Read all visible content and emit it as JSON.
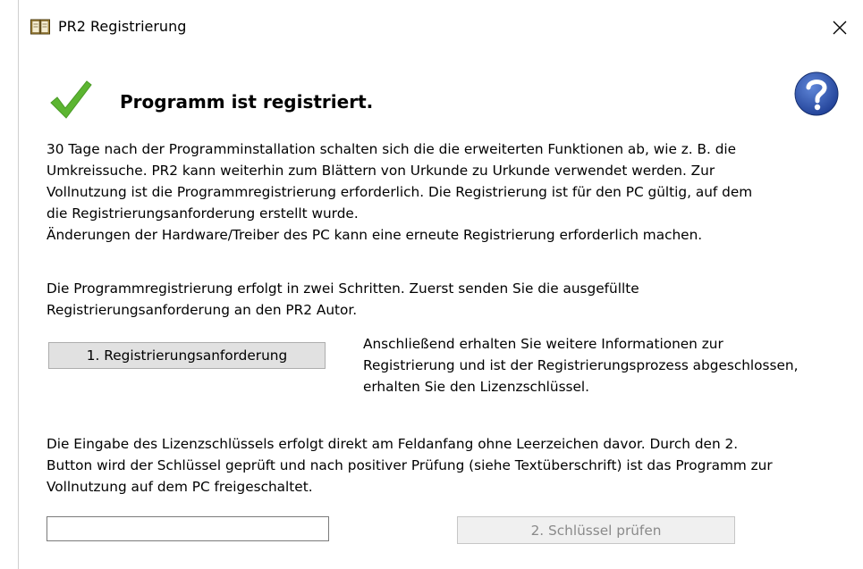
{
  "window": {
    "title": "PR2 Registrierung",
    "close_label": "✕"
  },
  "status": {
    "heading": "Programm ist registriert.",
    "icon": "checkmark-icon",
    "color": "#5cb531"
  },
  "help": {
    "icon": "help-icon",
    "label": "?",
    "color": "#2a4fa8"
  },
  "paragraphs": {
    "p1": "30 Tage nach der Programminstallation schalten sich die die erweiterten Funktionen ab, wie z. B. die\nUmkreissuche. PR2 kann weiterhin zum Blättern von Urkunde zu Urkunde verwendet werden. Zur\nVollnutzung ist die Programmregistrierung erforderlich. Die Registrierung ist für den PC gültig, auf dem\ndie Registrierungsanforderung erstellt wurde.\nÄnderungen der Hardware/Treiber des PC kann eine erneute Registrierung erforderlich machen.",
    "p2": "Die Programmregistrierung erfolgt in zwei Schritten. Zuerst senden Sie die ausgefüllte\nRegistrierungsanforderung an den PR2 Autor.",
    "p3": "Anschließend erhalten Sie weitere Informationen zur\nRegistrierung und ist der Registrierungsprozess abgeschlossen,\nerhalten Sie den Lizenzschlüssel.",
    "p4": "Die Eingabe des Lizenzschlüssels erfolgt direkt am Feldanfang ohne Leerzeichen davor. Durch den 2.\nButton wird der Schlüssel geprüft und nach positiver Prüfung (siehe Textüberschrift) ist das Programm zur\nVollnutzung auf dem PC freigeschaltet."
  },
  "buttons": {
    "request": "1. Registrierungsanforderung",
    "verify": "2. Schlüssel prüfen"
  },
  "license_input": {
    "value": "",
    "placeholder": ""
  }
}
